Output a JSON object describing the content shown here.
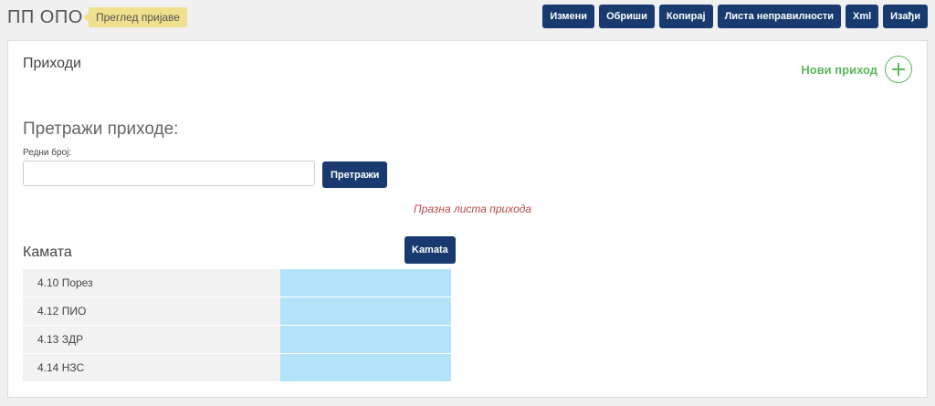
{
  "header": {
    "app_title": "ПП ОПО",
    "badge": "Преглед пријаве",
    "toolbar": {
      "edit": "Измени",
      "delete": "Обриши",
      "copy": "Копирај",
      "irregularities": "Листа неправилности",
      "xml": "Xml",
      "exit": "Изађи"
    }
  },
  "income_section": {
    "title": "Приходи",
    "new_income_label": "Нови приход",
    "search_heading": "Претражи приходе:",
    "ordinal_label": "Редни број:",
    "ordinal_value": "",
    "search_button": "Претражи",
    "empty_message": "Празна листа прихода"
  },
  "interest_section": {
    "title": "Камата",
    "button": "Kamata",
    "rows": [
      {
        "label": "4.10 Порез",
        "value": ""
      },
      {
        "label": "4.12 ПИО",
        "value": ""
      },
      {
        "label": "4.13 ЗДР",
        "value": ""
      },
      {
        "label": "4.14 НЗС",
        "value": ""
      }
    ]
  },
  "colors": {
    "primary_button": "#183a6e",
    "badge": "#f0df8c",
    "success": "#5cb85c",
    "error_text": "#b94a48",
    "value_cell": "#b3e3f9"
  }
}
